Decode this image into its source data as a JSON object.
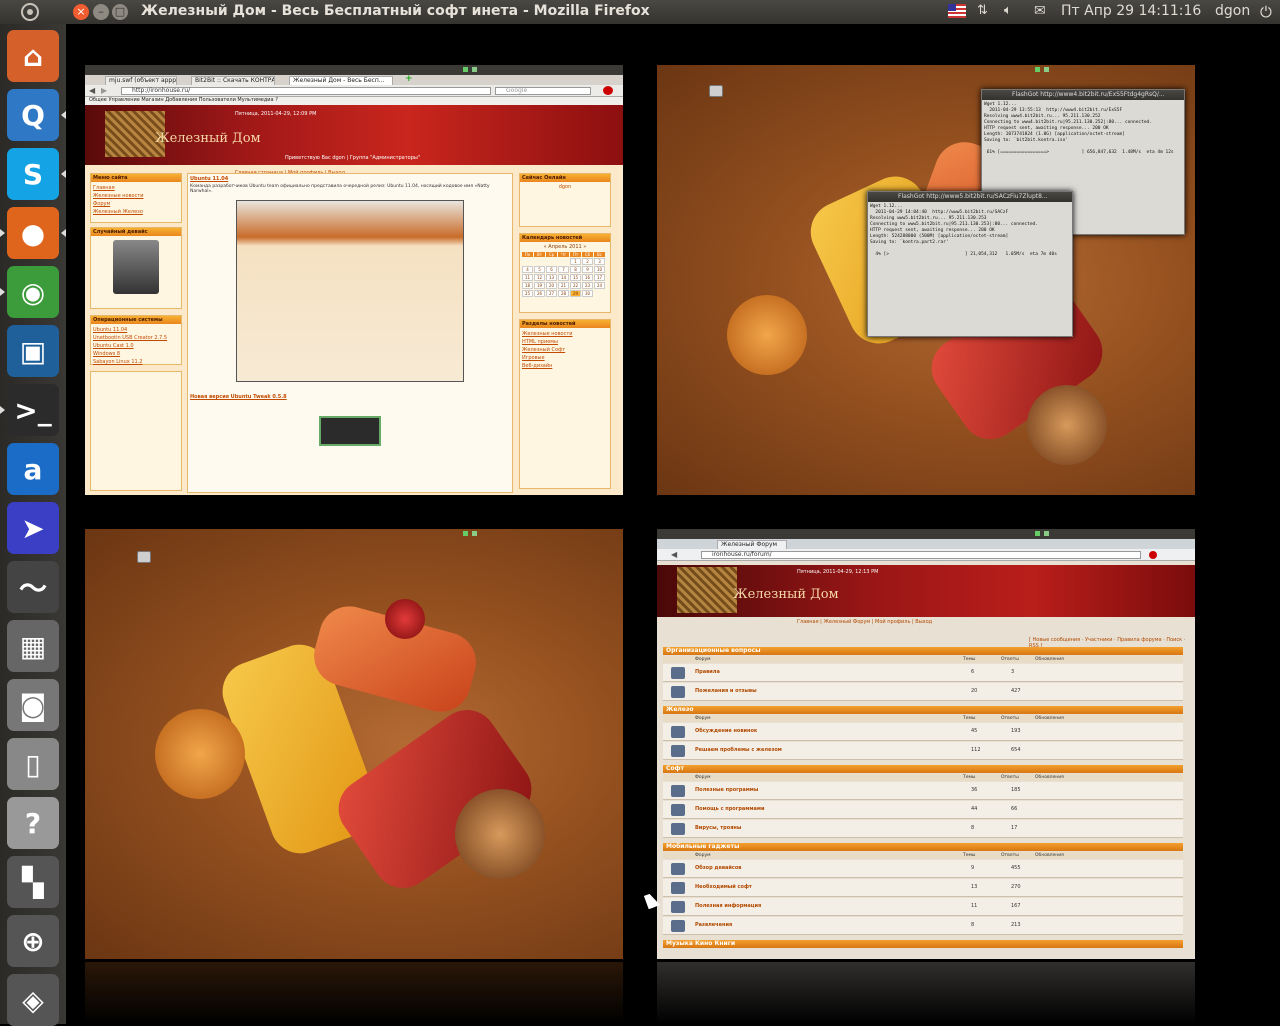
{
  "topbar": {
    "window_title": "Железный Дом - Весь Бесплатный софт инета - Mozilla Firefox",
    "close_label": "×",
    "minimize_label": "–",
    "maximize_label": "□",
    "datetime": "Пт Апр 29 14:11:16",
    "username": "dgon",
    "indicators": [
      "flag-us-icon",
      "network-arrows-icon",
      "volume-icon",
      "mail-icon"
    ]
  },
  "launcher": {
    "items": [
      {
        "name": "home-folder",
        "glyph": "⌂",
        "color": "#d5602a"
      },
      {
        "name": "qutim",
        "glyph": "Q",
        "color": "#2f78c6"
      },
      {
        "name": "skype",
        "glyph": "S",
        "color": "#14a3e4"
      },
      {
        "name": "firefox",
        "glyph": "●",
        "color": "#e0651c"
      },
      {
        "name": "chrome",
        "glyph": "◉",
        "color": "#3c9b3a"
      },
      {
        "name": "virtualbox",
        "glyph": "▣",
        "color": "#1f5f9a"
      },
      {
        "name": "terminal",
        "glyph": ">_",
        "color": "#2b2b2b"
      },
      {
        "name": "ama",
        "glyph": "a",
        "color": "#1b6cc6"
      },
      {
        "name": "transmission",
        "glyph": "➤",
        "color": "#3a3fc6"
      },
      {
        "name": "system-monitor",
        "glyph": "〜",
        "color": "#444"
      },
      {
        "name": "calculator",
        "glyph": "▦",
        "color": "#666"
      },
      {
        "name": "screenshot",
        "glyph": "◙",
        "color": "#777"
      },
      {
        "name": "libreoffice",
        "glyph": "▯",
        "color": "#888"
      },
      {
        "name": "help",
        "glyph": "?",
        "color": "#999"
      },
      {
        "name": "workspace-switcher",
        "glyph": "▚",
        "color": "#555"
      },
      {
        "name": "zoom",
        "glyph": "⊕",
        "color": "#555"
      },
      {
        "name": "trash",
        "glyph": "◈",
        "color": "#555"
      }
    ]
  },
  "workspace1": {
    "tabs": [
      "mju.swf (объект appplicati...",
      "Bit2Bit :: Скачать КОНТРА...",
      "Железный Дом - Весь Бесп..."
    ],
    "url": "http://ironhouse.ru/",
    "search_placeholder": "Google",
    "menu": "Общее   Управление   Магазин   Добавления   Пользователи   Мультимедиа   ?",
    "date": "Пятница, 2011-04-29, 12:09 PM",
    "logo": "Железный Дом",
    "greeting": "Приветствую Вас dgon | Группа \"Администраторы\"",
    "nav": "Главная страница | Мой профиль | Выход",
    "left_menu_title": "Меню сайта",
    "left_menu": [
      "Главная",
      "Железные новости",
      "Форум",
      "Железный Железо"
    ],
    "random_title": "Случайный девайс",
    "os_title": "Операционные системы",
    "os_items": [
      "Ubuntu 11.04",
      "Unetbootin USB Creator 2.7.5",
      "Ubuntu Cast 1.0",
      "Windows 8",
      "Sabayon Linux 11.2"
    ],
    "post_title": "Ubuntu 11.04",
    "post_text": "Команда разработчиков Ubuntu team официально представила очередной релиз: Ubuntu 11.04, носящий кодовое имя «Natty Narwhal».",
    "post2_title": "Новая версия Ubuntu Tweak 0.5.8",
    "online_title": "Сейчас Онлайн",
    "online_user": "dgon",
    "calendar_title": "Календарь новостей",
    "calendar_month": "« Апрель 2011 »",
    "sections_title": "Разделы новостей",
    "sections": [
      "Железные новости",
      "HTML приемы",
      "Железный Софт",
      "Игровые",
      "Веб-дизайн"
    ]
  },
  "workspace2": {
    "term1_title": "FlashGot http://www4.bit2bit.ru/ExS5Ftdg4gRsQ/...",
    "term1_text": "Wget 1.12...\n  2011-04-29 13:55:13  http://www4.bit2bit.ru/ExS5F\nResolving www4.bit2bit.ru... 95.211.130.252\nConnecting to www4.bit2bit.ru|95.211.130.252|:80... connected.\nHTTP request sent, awaiting response... 200 OK\nLength: 1073741824 (1.0G) [application/octet-stream]\nSaving to: `bit2bit.kontra.iso'\n\n 61% [=================>            ] 656,847,632  1.48M/s  eta 4m 12s",
    "term2_title": "FlashGot http://www5.bit2bit.ru/SACzFiu7Zlupt8...",
    "term2_text": "Wget 1.12...\n  2011-04-29 14:04:40  http://www5.bit2bit.ru/SACzF\nResolving www5.bit2bit.ru... 95.211.130.253\nConnecting to www5.bit2bit.ru|95.211.130.253|:80... connected.\nHTTP request sent, awaiting response... 200 OK\nLength: 524288000 (500M) [application/octet-stream]\nSaving to: `kontra.part2.rar'\n\n  4% [>                            ] 21,054,312   1.05M/s  eta 7m 40s"
  },
  "workspace4": {
    "tab": "Железный Форум",
    "url": "ironhouse.ru/forum/",
    "date": "Пятница, 2011-04-29, 12:13 PM",
    "logo": "Железный Дом",
    "nav": "Главная | Железный Форум | Мой профиль | Выход",
    "links": "[ Новые сообщения · Участники · Правила форума · Поиск · RSS ]",
    "col_forum": "Форум",
    "col_topics": "Темы",
    "col_replies": "Ответы",
    "col_updated": "Обновления",
    "sections": [
      {
        "title": "Организационные вопросы",
        "rows": [
          {
            "name": "Правила",
            "t": "6",
            "r": "3"
          },
          {
            "name": "Пожелания и отзывы",
            "t": "20",
            "r": "427"
          }
        ]
      },
      {
        "title": "Железо",
        "rows": [
          {
            "name": "Обсуждение новинок",
            "t": "45",
            "r": "193"
          },
          {
            "name": "Решаем проблемы с железом",
            "t": "112",
            "r": "654"
          }
        ]
      },
      {
        "title": "Софт",
        "rows": [
          {
            "name": "Полезные программы",
            "t": "36",
            "r": "185"
          },
          {
            "name": "Помощь с программами",
            "t": "44",
            "r": "66"
          },
          {
            "name": "Вирусы, трояны",
            "t": "8",
            "r": "17"
          }
        ]
      },
      {
        "title": "Мобильные гаджеты",
        "rows": [
          {
            "name": "Обзор девайсов",
            "t": "9",
            "r": "455"
          },
          {
            "name": "Необходимый софт",
            "t": "13",
            "r": "270"
          },
          {
            "name": "Полезная информация",
            "t": "11",
            "r": "167"
          },
          {
            "name": "Развлечения",
            "t": "8",
            "r": "213"
          }
        ]
      },
      {
        "title": "Музыка Кино Книги",
        "rows": []
      }
    ]
  }
}
